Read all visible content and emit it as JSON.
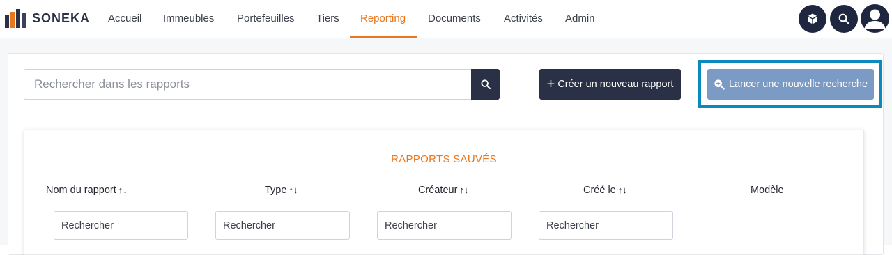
{
  "brand": {
    "name": "SONEKA"
  },
  "nav": {
    "items": [
      {
        "label": "Accueil",
        "active": false
      },
      {
        "label": "Immeubles",
        "active": false
      },
      {
        "label": "Portefeuilles",
        "active": false
      },
      {
        "label": "Tiers",
        "active": false
      },
      {
        "label": "Reporting",
        "active": true
      },
      {
        "label": "Documents",
        "active": false
      },
      {
        "label": "Activités",
        "active": false
      },
      {
        "label": "Admin",
        "active": false
      }
    ],
    "icons": [
      "cube-icon",
      "search-icon",
      "user-avatar-icon"
    ]
  },
  "search": {
    "placeholder": "Rechercher dans les rapports",
    "value": ""
  },
  "actions": {
    "create_label": "Créer un nouveau rapport",
    "new_search_label": "Lancer une nouvelle recherche"
  },
  "reports": {
    "title": "RAPPORTS SAUVÉS",
    "columns": [
      {
        "label": "Nom du rapport",
        "sortable": true
      },
      {
        "label": "Type",
        "sortable": true
      },
      {
        "label": "Créateur",
        "sortable": true
      },
      {
        "label": "Créé le",
        "sortable": true
      },
      {
        "label": "Modèle",
        "sortable": false
      }
    ],
    "sort_glyph": "↑↓",
    "filter_placeholder": "Rechercher"
  },
  "colors": {
    "accent": "#e8771d",
    "dark": "#2a3146",
    "secondary_button": "#7b9bc4",
    "highlight": "#0b8bbd"
  }
}
